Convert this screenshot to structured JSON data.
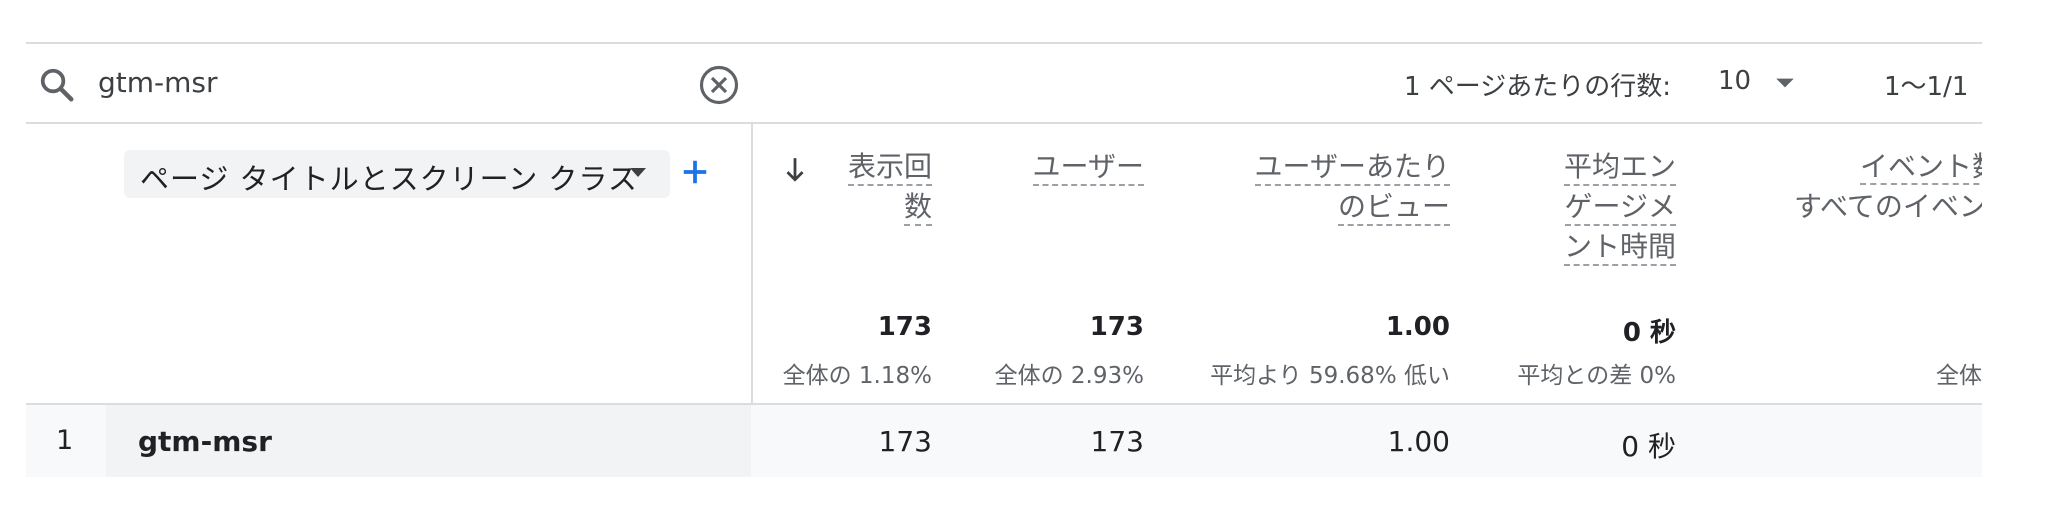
{
  "search": {
    "value": "gtm-msr"
  },
  "pagination": {
    "rows_per_page_label": "1 ページあたりの行数:",
    "rows_per_page_value": "10",
    "range": "1〜1/1"
  },
  "dimension": {
    "label": "ページ タイトルとスクリーン クラス"
  },
  "columns": [
    {
      "line1": "表示回",
      "line2": "数",
      "line3": ""
    },
    {
      "line1": "ユーザー",
      "line2": "",
      "line3": ""
    },
    {
      "line1": "ユーザーあたり",
      "line2": "のビュー",
      "line3": ""
    },
    {
      "line1": "平均エン",
      "line2": "ゲージメ",
      "line3": "ント時間"
    },
    {
      "line1": "イベント数",
      "line2": "すべてのイベン",
      "line3": ""
    }
  ],
  "totals": [
    {
      "value": "173",
      "sub": "全体の 1.18%"
    },
    {
      "value": "173",
      "sub": "全体の 2.93%"
    },
    {
      "value": "1.00",
      "sub": "平均より 59.68% 低い"
    },
    {
      "value": "0 秒",
      "sub": "平均との差 0%"
    },
    {
      "value": "",
      "sub": "全体"
    }
  ],
  "rows": [
    {
      "index": "1",
      "dimension": "gtm-msr",
      "values": [
        "173",
        "173",
        "1.00",
        "0 秒"
      ]
    }
  ]
}
